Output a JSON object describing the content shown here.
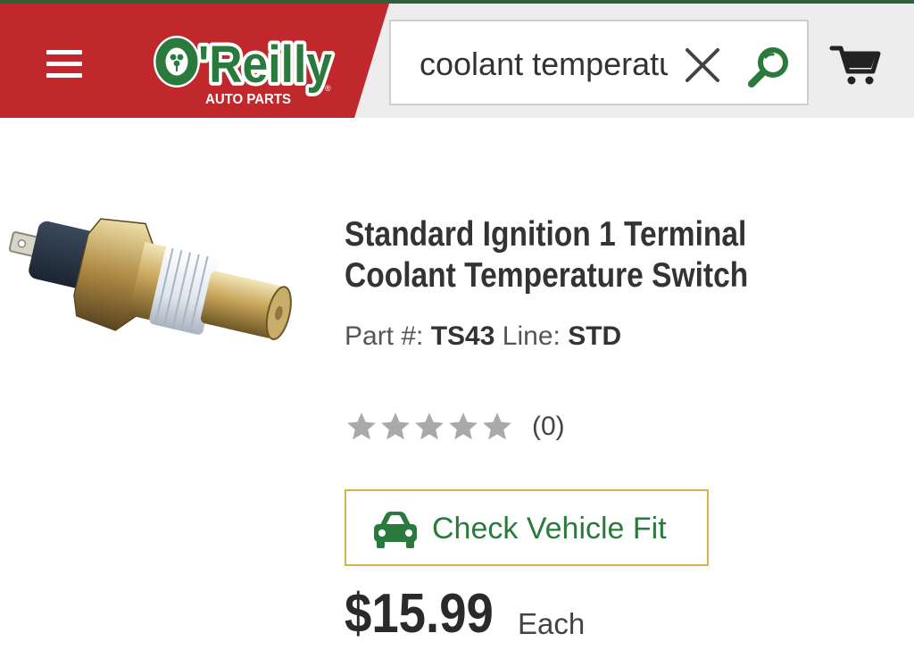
{
  "header": {
    "brand": "O'Reilly",
    "brand_sub": "AUTO PARTS",
    "brand_mark": "®",
    "menu_icon": "hamburger-menu-icon",
    "cart_icon": "cart-icon",
    "colors": {
      "red": "#c0282c",
      "green": "#2b7a3d",
      "bar": "#ededed"
    }
  },
  "search": {
    "value": "coolant temperature switch",
    "clear_icon": "close-icon",
    "search_icon": "search-icon"
  },
  "product": {
    "title_line1": "Standard Ignition 1 Terminal",
    "title_line2": "Coolant Temperature Switch",
    "part_label": "Part #:",
    "part_number": "TS43",
    "line_label": "Line:",
    "line_value": "STD",
    "rating": 0,
    "rating_max": 5,
    "review_count": "(0)",
    "fit_button": "Check Vehicle Fit",
    "fit_icon": "car-icon",
    "price": "$15.99",
    "price_unit": "Each",
    "accent_border": "#d4b24c"
  }
}
